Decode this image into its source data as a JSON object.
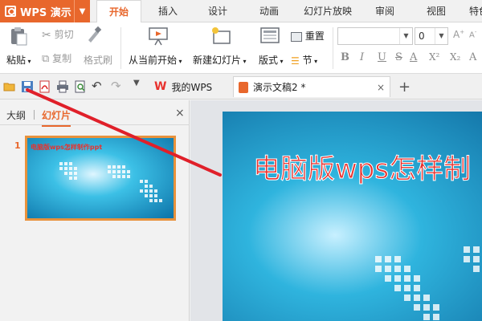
{
  "app": {
    "name": "WPS 演示"
  },
  "menu": {
    "tabs": [
      "开始",
      "插入",
      "设计",
      "动画",
      "幻灯片放映",
      "审阅",
      "视图",
      "特色"
    ],
    "active_tab": "开始"
  },
  "ribbon": {
    "paste": "粘贴",
    "cut": "剪切",
    "copy": "复制",
    "format_painter": "格式刷",
    "from_current": "从当前开始",
    "new_slide": "新建幻灯片",
    "layout": "版式",
    "reset": "重置",
    "section": "节",
    "font_size": "0",
    "format_buttons": [
      "B",
      "I",
      "U",
      "S",
      "A",
      "X²",
      "X₂",
      "A"
    ]
  },
  "quick_access": {
    "doc_tabs": [
      {
        "label": "我的WPS"
      },
      {
        "label": "演示文稿2 *"
      }
    ],
    "add_tab": "+"
  },
  "left_pane": {
    "tab_outline": "大纲",
    "tab_slides": "幻灯片",
    "close": "×",
    "slide_number": "1",
    "thumb_title": "电脑版wps怎样制作ppt"
  },
  "slide": {
    "title": "电脑版wps怎样制"
  },
  "colors": {
    "accent": "#e8672c",
    "title_red": "#e8312d",
    "slide_blue": "#1aa3c8",
    "annotation_red": "#e0202a"
  }
}
